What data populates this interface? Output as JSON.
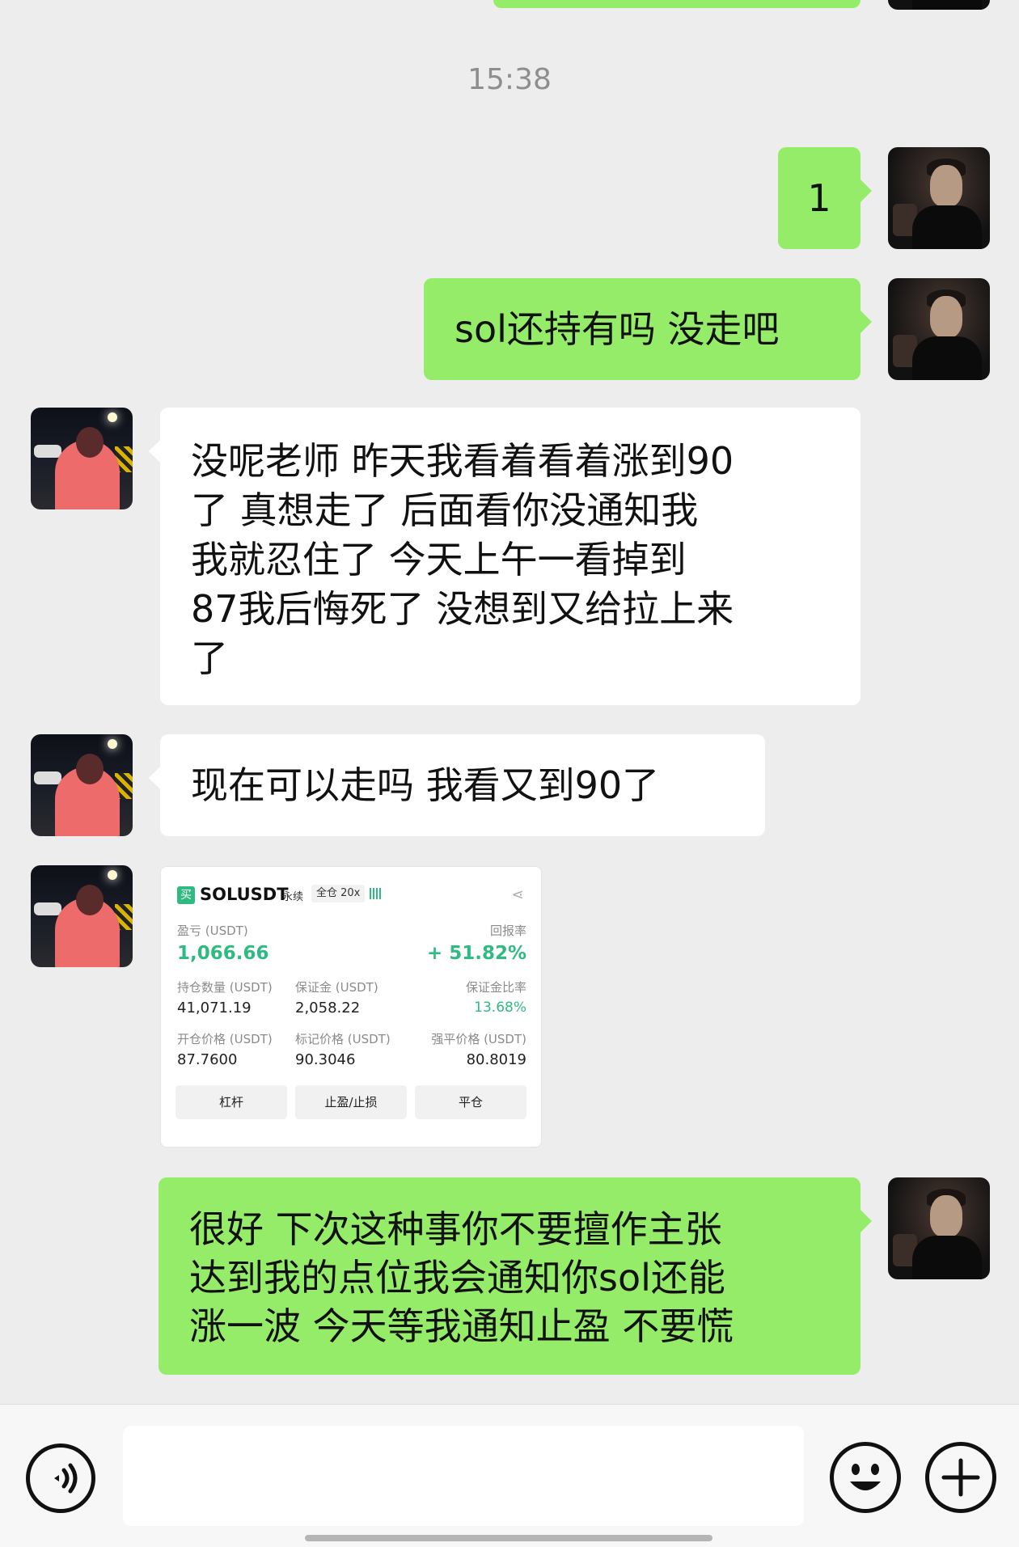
{
  "chat": {
    "timestamp": "15:38",
    "messages": [
      {
        "sender": "me",
        "text": "1"
      },
      {
        "sender": "me",
        "text": "sol还持有吗 没走吧"
      },
      {
        "sender": "them",
        "lines": [
          "没呢老师 昨天我看着看着涨到90",
          "了 真想走了 后面看你没通知我",
          "我就忍住了  今天上午一看掉到",
          "87我后悔死了 没想到又给拉上来",
          "了"
        ]
      },
      {
        "sender": "them",
        "text": "现在可以走吗 我看又到90了"
      },
      {
        "sender": "them",
        "type": "image"
      },
      {
        "sender": "me",
        "lines": [
          "很好 下次这种事你不要擅作主张",
          "达到我的点位我会通知你sol还能",
          "涨一波 今天等我通知止盈 不要慌"
        ]
      }
    ]
  },
  "trade_card": {
    "buy_badge": "买",
    "symbol": "SOLUSDT",
    "contract_type": "永续",
    "margin_mode": "全仓 20x",
    "pnl_label": "盈亏 (USDT)",
    "pnl_value": "1,066.66",
    "roi_label": "回报率",
    "roi_value": "+ 51.82%",
    "position_label": "持仓数量 (USDT)",
    "position_value": "41,071.19",
    "margin_label": "保证金 (USDT)",
    "margin_value": "2,058.22",
    "margin_ratio_label": "保证金比率",
    "margin_ratio_value": "13.68%",
    "entry_label": "开仓价格 (USDT)",
    "entry_value": "87.7600",
    "mark_label": "标记价格 (USDT)",
    "mark_value": "90.3046",
    "liq_label": "强平价格 (USDT)",
    "liq_value": "80.8019",
    "buttons": [
      "杠杆",
      "止盈/止损",
      "平仓"
    ],
    "accent_color": "#2eba80"
  },
  "input_bar": {
    "placeholder": "",
    "icons": [
      "voice-icon",
      "emoji-icon",
      "plus-icon"
    ]
  },
  "colors": {
    "background": "#ededed",
    "my_bubble": "#95ec69",
    "their_bubble": "#ffffff"
  }
}
